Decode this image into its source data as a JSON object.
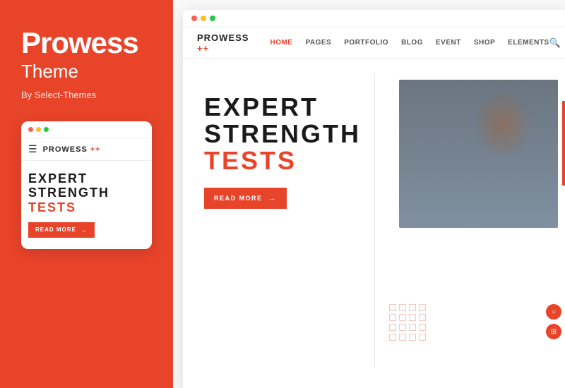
{
  "left": {
    "title": "Prowess",
    "subtitle": "Theme",
    "by_line": "By Select-Themes"
  },
  "mobile_preview": {
    "dots": [
      "red",
      "yellow",
      "green"
    ],
    "nav": {
      "logo": "PROWESS",
      "logo_plus": " ++"
    },
    "hero": {
      "line1": "EXPERT",
      "line2": "STRENGTH",
      "highlight": "TESTS",
      "cta": "READ MORE",
      "arrow": "→"
    }
  },
  "desktop_preview": {
    "titlebar_dots": [
      "red",
      "yellow",
      "green"
    ],
    "nav": {
      "logo": "PROWESS",
      "logo_plus": " ++",
      "links": [
        "HOME",
        "PAGES",
        "PORTFOLIO",
        "BLOG",
        "EVENT",
        "SHOP",
        "ELEMENTS"
      ],
      "active_link": "HOME"
    },
    "hero": {
      "line1": "EXPERT",
      "line2": "STRENGTH",
      "highlight": "TESTS",
      "cta": "READ MORE",
      "arrow": "→"
    }
  },
  "colors": {
    "accent": "#e8442a",
    "dark": "#1a1a1a",
    "text_muted": "#555"
  }
}
